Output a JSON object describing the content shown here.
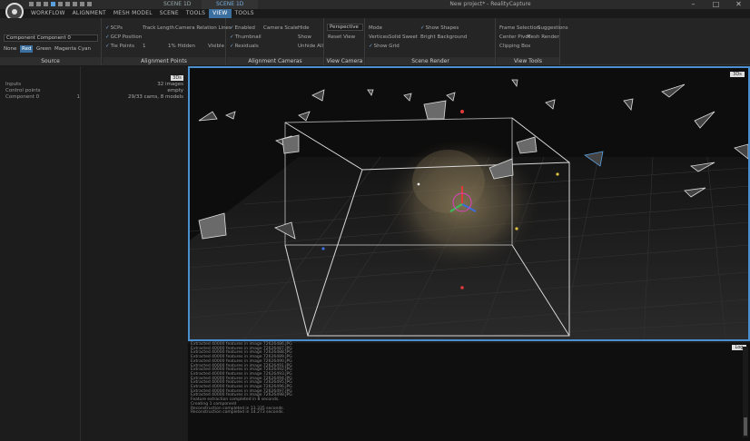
{
  "app": {
    "title": "New project* - RealityCapture",
    "tabs": [
      "SCENE 1D",
      "SCENE 1D"
    ],
    "window_controls": [
      "–",
      "□",
      "✕"
    ]
  },
  "menu": [
    "WORKFLOW",
    "ALIGNMENT",
    "MESH MODEL",
    "SCENE",
    "TOOLS",
    "VIEW",
    "TOOLS"
  ],
  "ribbon": {
    "source": {
      "label": "Source",
      "component_combo": "Component Component 0",
      "colors": [
        "None",
        "Red",
        "Green",
        "Magenta",
        "Cyan"
      ],
      "selected_color": "Red"
    },
    "alignment_points": {
      "label": "Alignment Points",
      "items": [
        "SCPs",
        "GCP Position",
        "Tie Points"
      ],
      "track_length_label": "Track Length",
      "track_length_value": "1",
      "camera_relation_label": "Camera Relation Lines",
      "hidden_label": "1% Hidden",
      "visible_label": "Visible"
    },
    "alignment_cameras": {
      "label": "Alignment Cameras",
      "items": [
        "Enabled",
        "Thumbnail",
        "Residuals"
      ],
      "camera_scale_label": "Camera Scale",
      "hide_label": "Hide",
      "show_label": "Show",
      "unhide_label": "Unhide All"
    },
    "view_camera": {
      "label": "View Camera",
      "projection": "Perspective",
      "reset_label": "Reset View"
    },
    "scene_render": {
      "label": "Scene Render",
      "mode_label": "Mode",
      "modes": [
        "Vertices",
        "Solid",
        "Sweet"
      ],
      "show_grid": "Show Grid",
      "show_shapes": "Show Shapes",
      "bright_background": "Bright Background"
    },
    "view_tools": {
      "label": "View Tools",
      "frame_selection": "Frame Selection",
      "suggestions": "Suggestions",
      "center_pivot": "Center Pivot",
      "mesh_render": "Mesh Render",
      "clipping_box": "Clipping Box"
    }
  },
  "left_panel": {
    "tree": [
      {
        "label": "Inputs",
        "value": ""
      },
      {
        "label": "Control points",
        "value": ""
      },
      {
        "label": "Component 0",
        "value": "1"
      }
    ],
    "info": [
      "32 images",
      "empty",
      "29/33 cams, 8 models"
    ],
    "badge": "3Ds"
  },
  "viewport": {
    "badge": "3Ds"
  },
  "console": {
    "badge": "Log",
    "lines": [
      "Extracted 40000 features in image 72626486.JPG",
      "Extracted 40000 features in image 72626487.JPG",
      "Extracted 40000 features in image 72626488.JPG",
      "Extracted 40000 features in image 72626489.JPG",
      "Extracted 40000 features in image 72626490.JPG",
      "Extracted 40000 features in image 72626491.JPG",
      "Extracted 40000 features in image 72626492.JPG",
      "Extracted 40000 features in image 72626493.JPG",
      "Extracted 40000 features in image 72626494.JPG",
      "Extracted 40000 features in image 72626495.JPG",
      "Extracted 40000 features in image 72626496.JPG",
      "Extracted 40000 features in image 72626497.JPG",
      "Extracted 40000 features in image 72626498.JPG",
      "Feature extraction completed in 8 seconds.",
      "Creating 1 component",
      "Reconstruction completed in 13.335 seconds.",
      "Reconstruction completed in 14.273 seconds."
    ]
  }
}
